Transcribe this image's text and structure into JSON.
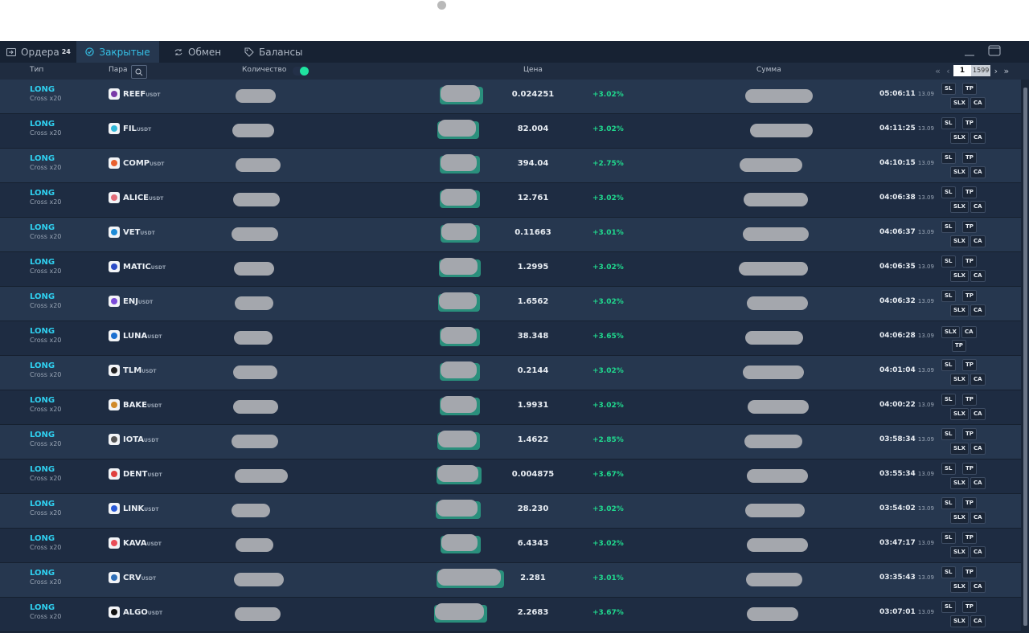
{
  "tabs": [
    {
      "label": "Ордера",
      "badge": "24",
      "icon": "enter-icon"
    },
    {
      "label": "Закрытые",
      "badge": "",
      "icon": "check-circle-icon"
    },
    {
      "label": "Обмен",
      "badge": "",
      "icon": "swap-icon"
    },
    {
      "label": "Балансы",
      "badge": "",
      "icon": "tag-icon"
    }
  ],
  "columns": {
    "type": "Тип",
    "pair": "Пара",
    "quantity": "Количество",
    "price": "Цена",
    "amount": "Сумма"
  },
  "pagination": {
    "current": "1",
    "total": "1599"
  },
  "colors": {
    "accent": "#35c0e6",
    "long": "#2fd0f0",
    "positive": "#20d98e",
    "toggle_on": "#1fe3a0"
  },
  "rows": [
    {
      "type": "LONG",
      "margin": "Cross x20",
      "symbol": "REEF",
      "quote": "USDT",
      "price": "0.024251",
      "change": "+3.02%",
      "time": "05:06:11",
      "date": "13.09"
    },
    {
      "type": "LONG",
      "margin": "Cross x20",
      "symbol": "FIL",
      "quote": "USDT",
      "price": "82.004",
      "change": "+3.02%",
      "time": "04:11:25",
      "date": "13.09"
    },
    {
      "type": "LONG",
      "margin": "Cross x20",
      "symbol": "COMP",
      "quote": "USDT",
      "price": "394.04",
      "change": "+2.75%",
      "time": "04:10:15",
      "date": "13.09"
    },
    {
      "type": "LONG",
      "margin": "Cross x20",
      "symbol": "ALICE",
      "quote": "USDT",
      "price": "12.761",
      "change": "+3.02%",
      "time": "04:06:38",
      "date": "13.09"
    },
    {
      "type": "LONG",
      "margin": "Cross x20",
      "symbol": "VET",
      "quote": "USDT",
      "price": "0.11663",
      "change": "+3.01%",
      "time": "04:06:37",
      "date": "13.09"
    },
    {
      "type": "LONG",
      "margin": "Cross x20",
      "symbol": "MATIC",
      "quote": "USDT",
      "price": "1.2995",
      "change": "+3.02%",
      "time": "04:06:35",
      "date": "13.09"
    },
    {
      "type": "LONG",
      "margin": "Cross x20",
      "symbol": "ENJ",
      "quote": "USDT",
      "price": "1.6562",
      "change": "+3.02%",
      "time": "04:06:32",
      "date": "13.09"
    },
    {
      "type": "LONG",
      "margin": "Cross x20",
      "symbol": "LUNA",
      "quote": "USDT",
      "price": "38.348",
      "change": "+3.65%",
      "time": "04:06:28",
      "date": "13.09"
    },
    {
      "type": "LONG",
      "margin": "Cross x20",
      "symbol": "TLM",
      "quote": "USDT",
      "price": "0.2144",
      "change": "+3.02%",
      "time": "04:01:04",
      "date": "13.09"
    },
    {
      "type": "LONG",
      "margin": "Cross x20",
      "symbol": "BAKE",
      "quote": "USDT",
      "price": "1.9931",
      "change": "+3.02%",
      "time": "04:00:22",
      "date": "13.09"
    },
    {
      "type": "LONG",
      "margin": "Cross x20",
      "symbol": "IOTA",
      "quote": "USDT",
      "price": "1.4622",
      "change": "+2.85%",
      "time": "03:58:34",
      "date": "13.09"
    },
    {
      "type": "LONG",
      "margin": "Cross x20",
      "symbol": "DENT",
      "quote": "USDT",
      "price": "0.004875",
      "change": "+3.67%",
      "time": "03:55:34",
      "date": "13.09"
    },
    {
      "type": "LONG",
      "margin": "Cross x20",
      "symbol": "LINK",
      "quote": "USDT",
      "price": "28.230",
      "change": "+3.02%",
      "time": "03:54:02",
      "date": "13.09"
    },
    {
      "type": "LONG",
      "margin": "Cross x20",
      "symbol": "KAVA",
      "quote": "USDT",
      "price": "6.4343",
      "change": "+3.02%",
      "time": "03:47:17",
      "date": "13.09"
    },
    {
      "type": "LONG",
      "margin": "Cross x20",
      "symbol": "CRV",
      "quote": "USDT",
      "price": "2.281",
      "change": "+3.01%",
      "time": "03:35:43",
      "date": "13.09"
    },
    {
      "type": "LONG",
      "margin": "Cross x20",
      "symbol": "ALGO",
      "quote": "USDT",
      "price": "2.2683",
      "change": "+3.67%",
      "time": "03:07:01",
      "date": "13.09"
    }
  ],
  "row_buttons": {
    "sl": "SL",
    "tp": "TP",
    "slx": "SLX",
    "ca": "CA"
  }
}
